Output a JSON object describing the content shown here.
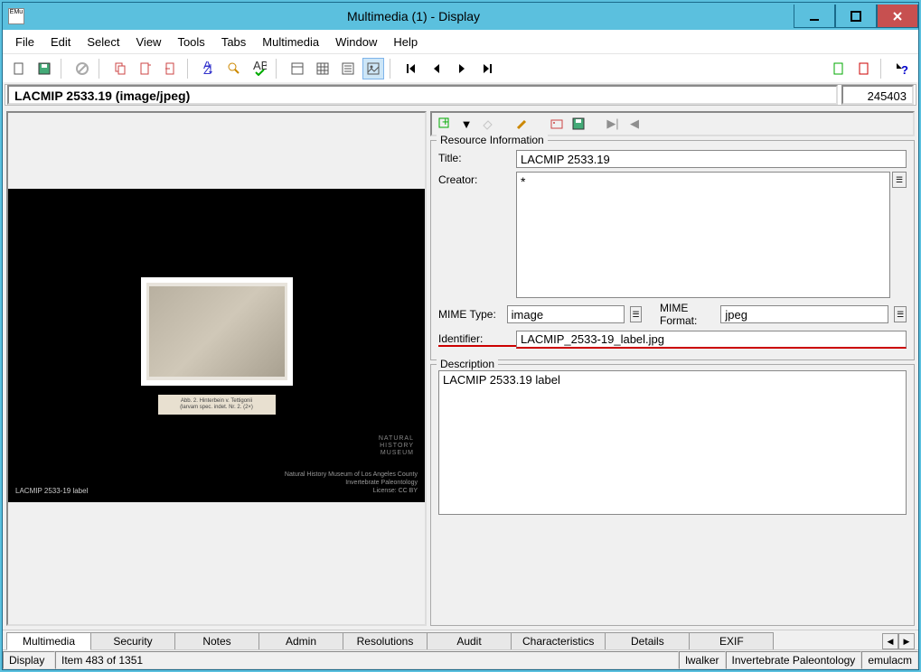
{
  "window": {
    "title": "Multimedia (1) - Display",
    "record_count": "245403"
  },
  "menubar": [
    "File",
    "Edit",
    "Select",
    "View",
    "Tools",
    "Tabs",
    "Multimedia",
    "Window",
    "Help"
  ],
  "header": {
    "title": "LACMIP 2533.19 (image/jpeg)"
  },
  "image": {
    "bottom_left_label": "LACMIP 2533-19 label",
    "museum_logo": "NATURAL\nHISTORY\nMUSEUM",
    "credits": "Natural History Museum of Los Angeles County\nInvertebrate Paleontology\nLicense: CC BY",
    "specimen_caption": "Abb. 2. Hinterbein v. Tettigonii\n(larvam spec. indet. Nr. 2. (2×)"
  },
  "resource_info": {
    "legend": "Resource Information",
    "title_label": "Title:",
    "title_value": "LACMIP 2533.19",
    "creator_label": "Creator:",
    "creator_marker": "*",
    "mime_type_label": "MIME Type:",
    "mime_type_value": "image",
    "mime_format_label": "MIME Format:",
    "mime_format_value": "jpeg",
    "identifier_label": "Identifier:",
    "identifier_value": "LACMIP_2533-19_label.jpg"
  },
  "description": {
    "legend": "Description",
    "value": "LACMIP 2533.19 label"
  },
  "tabs": [
    "Multimedia",
    "Security",
    "Notes",
    "Admin",
    "Resolutions",
    "Audit",
    "Characteristics",
    "Details",
    "EXIF"
  ],
  "active_tab": "Multimedia",
  "statusbar": {
    "mode": "Display",
    "position": "Item 483 of 1351",
    "user": "lwalker",
    "dept": "Invertebrate Paleontology",
    "server": "emulacm"
  }
}
